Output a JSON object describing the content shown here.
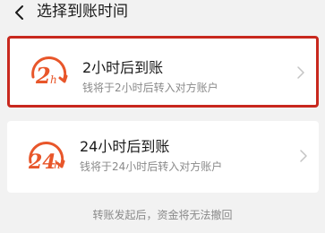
{
  "header": {
    "title": "选择到账时间",
    "back_icon": "chevron-left-icon"
  },
  "options": [
    {
      "logo_text": "2h",
      "title": "2小时后到账",
      "desc": "钱将于2小时后转入对方账户",
      "selected": true
    },
    {
      "logo_text": "24h",
      "title": "24小时后到账",
      "desc": "钱将于24小时后转入对方账户",
      "selected": false
    }
  ],
  "notice": "转账发起后，资金将无法撤回",
  "colors": {
    "accent": "#c8281e",
    "logo_orange": "#e8562a",
    "text_secondary": "#8a8a8a",
    "background": "#f2f2f2"
  }
}
